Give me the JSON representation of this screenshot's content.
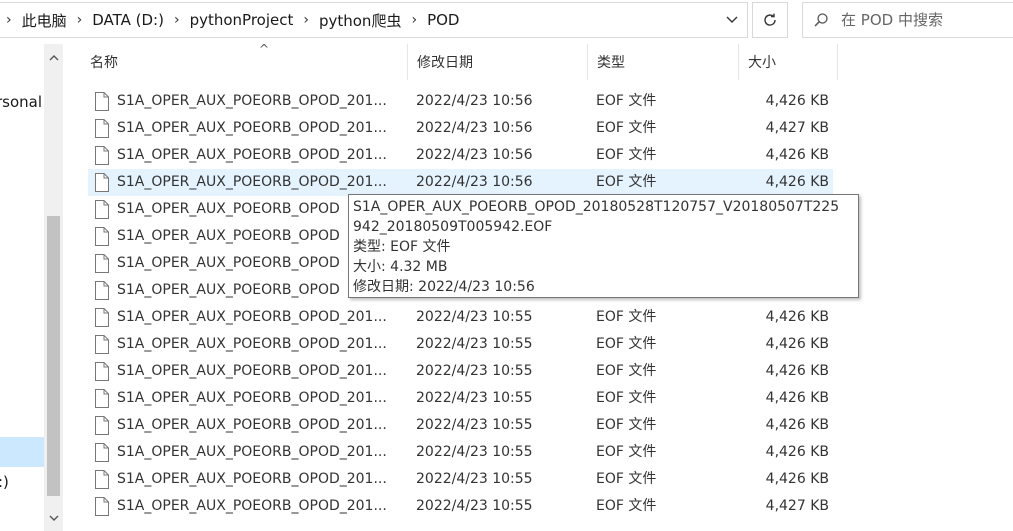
{
  "breadcrumb": {
    "items": [
      "此电脑",
      "DATA (D:)",
      "pythonProject",
      "python爬虫",
      "POD"
    ],
    "separator": "›"
  },
  "search": {
    "placeholder": "在 POD 中搜索"
  },
  "nav": {
    "visible_items": [
      "rsonal",
      ":)"
    ]
  },
  "columns": {
    "name": "名称",
    "date": "修改日期",
    "type": "类型",
    "size": "大小"
  },
  "files": [
    {
      "name": "S1A_OPER_AUX_POEORB_OPOD_201...",
      "date": "2022/4/23 10:56",
      "type": "EOF 文件",
      "size": "4,426 KB"
    },
    {
      "name": "S1A_OPER_AUX_POEORB_OPOD_201...",
      "date": "2022/4/23 10:56",
      "type": "EOF 文件",
      "size": "4,427 KB"
    },
    {
      "name": "S1A_OPER_AUX_POEORB_OPOD_201...",
      "date": "2022/4/23 10:56",
      "type": "EOF 文件",
      "size": "4,426 KB"
    },
    {
      "name": "S1A_OPER_AUX_POEORB_OPOD_201...",
      "date": "2022/4/23 10:56",
      "type": "EOF 文件",
      "size": "4,426 KB"
    },
    {
      "name": "S1A_OPER_AUX_POEORB_OPOD",
      "date": "",
      "type": "",
      "size": ""
    },
    {
      "name": "S1A_OPER_AUX_POEORB_OPOD",
      "date": "",
      "type": "",
      "size": ""
    },
    {
      "name": "S1A_OPER_AUX_POEORB_OPOD",
      "date": "",
      "type": "",
      "size": ""
    },
    {
      "name": "S1A_OPER_AUX_POEORB_OPOD",
      "date": "",
      "type": "",
      "size": ""
    },
    {
      "name": "S1A_OPER_AUX_POEORB_OPOD_201...",
      "date": "2022/4/23 10:55",
      "type": "EOF 文件",
      "size": "4,426 KB"
    },
    {
      "name": "S1A_OPER_AUX_POEORB_OPOD_201...",
      "date": "2022/4/23 10:55",
      "type": "EOF 文件",
      "size": "4,426 KB"
    },
    {
      "name": "S1A_OPER_AUX_POEORB_OPOD_201...",
      "date": "2022/4/23 10:55",
      "type": "EOF 文件",
      "size": "4,426 KB"
    },
    {
      "name": "S1A_OPER_AUX_POEORB_OPOD_201...",
      "date": "2022/4/23 10:55",
      "type": "EOF 文件",
      "size": "4,426 KB"
    },
    {
      "name": "S1A_OPER_AUX_POEORB_OPOD_201...",
      "date": "2022/4/23 10:55",
      "type": "EOF 文件",
      "size": "4,426 KB"
    },
    {
      "name": "S1A_OPER_AUX_POEORB_OPOD_201...",
      "date": "2022/4/23 10:55",
      "type": "EOF 文件",
      "size": "4,426 KB"
    },
    {
      "name": "S1A_OPER_AUX_POEORB_OPOD_201...",
      "date": "2022/4/23 10:55",
      "type": "EOF 文件",
      "size": "4,426 KB"
    },
    {
      "name": "S1A_OPER_AUX_POEORB_OPOD_201...",
      "date": "2022/4/23 10:55",
      "type": "EOF 文件",
      "size": "4,427 KB"
    }
  ],
  "hovered_index": 3,
  "tooltip": {
    "line1": "S1A_OPER_AUX_POEORB_OPOD_20180528T120757_V20180507T225",
    "line2": "942_20180509T005942.EOF",
    "type": "类型: EOF 文件",
    "size": "大小: 4.32 MB",
    "modified": "修改日期: 2022/4/23 10:56"
  },
  "colors": {
    "hover": "#e5f3ff",
    "selected_nav": "#cce8ff",
    "scroll_thumb": "#c2c2c2"
  },
  "icons": [
    "chevron-down-icon",
    "refresh-icon",
    "search-icon",
    "file-icon",
    "scroll-up-icon",
    "scroll-down-icon"
  ]
}
